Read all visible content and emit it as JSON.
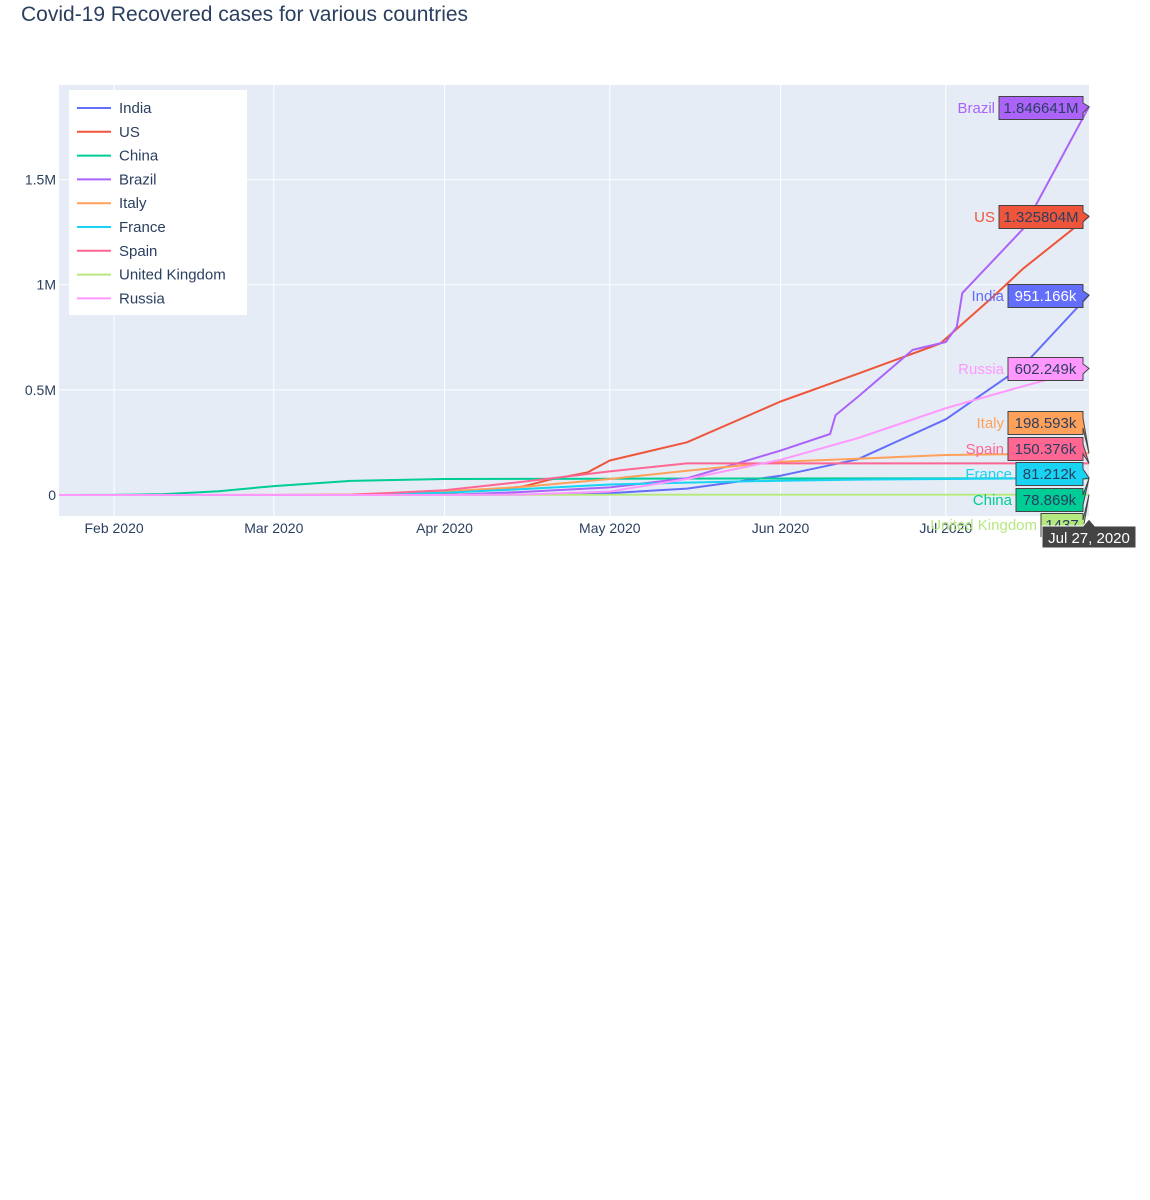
{
  "chart_data": {
    "type": "line",
    "title": "Covid-19 Recovered cases for various countries",
    "xlabel": "",
    "ylabel": "",
    "x_tick_labels": [
      "Feb 2020",
      "Mar 2020",
      "Apr 2020",
      "May 2020",
      "Jun 2020",
      "Jul 2020"
    ],
    "y_tick_labels": [
      "0",
      "0.5M",
      "1M",
      "1.5M"
    ],
    "x_range": [
      "2020-01-22",
      "2020-07-27"
    ],
    "ylim": [
      -100000,
      1950000
    ],
    "grid": true,
    "legend_position": "top-left",
    "hover": {
      "date_label": "Jul 27, 2020",
      "labels": {
        "Brazil": "1.846641M",
        "US": "1.325804M",
        "India": "951.166k",
        "Russia": "602.249k",
        "Italy": "198.593k",
        "Spain": "150.376k",
        "France": "81.212k",
        "China": "78.869k",
        "United Kingdom": "1437"
      }
    },
    "series": [
      {
        "name": "India",
        "color": "#636efa",
        "points": [
          [
            "2020-01-22",
            0
          ],
          [
            "2020-03-15",
            13
          ],
          [
            "2020-04-01",
            169
          ],
          [
            "2020-04-15",
            1749
          ],
          [
            "2020-05-01",
            9064
          ],
          [
            "2020-05-15",
            30153
          ],
          [
            "2020-06-01",
            91819
          ],
          [
            "2020-06-15",
            169798
          ],
          [
            "2020-07-01",
            359860
          ],
          [
            "2020-07-15",
            612815
          ],
          [
            "2020-07-27",
            951166
          ]
        ]
      },
      {
        "name": "US",
        "color": "#ef553b",
        "points": [
          [
            "2020-01-22",
            0
          ],
          [
            "2020-03-15",
            106
          ],
          [
            "2020-04-01",
            8474
          ],
          [
            "2020-04-15",
            38820
          ],
          [
            "2020-04-20",
            72329
          ],
          [
            "2020-04-27",
            108000
          ],
          [
            "2020-05-01",
            164015
          ],
          [
            "2020-05-15",
            250747
          ],
          [
            "2020-06-01",
            444758
          ],
          [
            "2020-06-15",
            576334
          ],
          [
            "2020-06-30",
            720631
          ],
          [
            "2020-07-10",
            953000
          ],
          [
            "2020-07-15",
            1075882
          ],
          [
            "2020-07-27",
            1325804
          ]
        ]
      },
      {
        "name": "China",
        "color": "#00cc96",
        "points": [
          [
            "2020-01-22",
            28
          ],
          [
            "2020-02-01",
            300
          ],
          [
            "2020-02-10",
            4000
          ],
          [
            "2020-02-20",
            18000
          ],
          [
            "2020-03-01",
            42000
          ],
          [
            "2020-03-15",
            67000
          ],
          [
            "2020-04-01",
            76000
          ],
          [
            "2020-05-01",
            77600
          ],
          [
            "2020-06-01",
            78300
          ],
          [
            "2020-07-01",
            78800
          ],
          [
            "2020-07-27",
            78869
          ]
        ]
      },
      {
        "name": "Brazil",
        "color": "#ab63fa",
        "points": [
          [
            "2020-01-22",
            0
          ],
          [
            "2020-04-01",
            120
          ],
          [
            "2020-04-15",
            14026
          ],
          [
            "2020-05-01",
            35935
          ],
          [
            "2020-05-15",
            79479
          ],
          [
            "2020-06-01",
            211080
          ],
          [
            "2020-06-10",
            290000
          ],
          [
            "2020-06-11",
            380000
          ],
          [
            "2020-06-15",
            466000
          ],
          [
            "2020-06-25",
            690000
          ],
          [
            "2020-07-01",
            727715
          ],
          [
            "2020-07-03",
            800000
          ],
          [
            "2020-07-04",
            960000
          ],
          [
            "2020-07-15",
            1264843
          ],
          [
            "2020-07-27",
            1846641
          ]
        ]
      },
      {
        "name": "Italy",
        "color": "#ffa15a",
        "points": [
          [
            "2020-01-22",
            0
          ],
          [
            "2020-03-01",
            83
          ],
          [
            "2020-03-15",
            2335
          ],
          [
            "2020-04-01",
            16847
          ],
          [
            "2020-04-15",
            38092
          ],
          [
            "2020-05-01",
            75945
          ],
          [
            "2020-05-15",
            115288
          ],
          [
            "2020-06-01",
            158355
          ],
          [
            "2020-06-15",
            172753
          ],
          [
            "2020-07-01",
            190248
          ],
          [
            "2020-07-27",
            198593
          ]
        ]
      },
      {
        "name": "France",
        "color": "#19d3f3",
        "points": [
          [
            "2020-01-22",
            0
          ],
          [
            "2020-03-15",
            12
          ],
          [
            "2020-04-01",
            10934
          ],
          [
            "2020-04-15",
            28000
          ],
          [
            "2020-05-01",
            50000
          ],
          [
            "2020-05-15",
            59000
          ],
          [
            "2020-06-01",
            68000
          ],
          [
            "2020-06-15",
            73000
          ],
          [
            "2020-07-01",
            76000
          ],
          [
            "2020-07-27",
            81212
          ]
        ]
      },
      {
        "name": "Spain",
        "color": "#ff6692",
        "points": [
          [
            "2020-01-22",
            0
          ],
          [
            "2020-03-15",
            1028
          ],
          [
            "2020-04-01",
            22647
          ],
          [
            "2020-04-15",
            62391
          ],
          [
            "2020-05-01",
            112050
          ],
          [
            "2020-05-15",
            150000
          ],
          [
            "2020-06-01",
            150376
          ],
          [
            "2020-07-27",
            150376
          ]
        ]
      },
      {
        "name": "United Kingdom",
        "color": "#b6e880",
        "points": [
          [
            "2020-01-22",
            0
          ],
          [
            "2020-03-15",
            19
          ],
          [
            "2020-04-01",
            359
          ],
          [
            "2020-05-01",
            859
          ],
          [
            "2020-06-01",
            1200
          ],
          [
            "2020-07-01",
            1400
          ],
          [
            "2020-07-27",
            1437
          ]
        ]
      },
      {
        "name": "Russia",
        "color": "#ff97ff",
        "points": [
          [
            "2020-01-22",
            0
          ],
          [
            "2020-04-01",
            121
          ],
          [
            "2020-04-15",
            1986
          ],
          [
            "2020-05-01",
            16639
          ],
          [
            "2020-05-15",
            76130
          ],
          [
            "2020-06-01",
            167469
          ],
          [
            "2020-06-15",
            270000
          ],
          [
            "2020-07-01",
            412650
          ],
          [
            "2020-07-15",
            517000
          ],
          [
            "2020-07-27",
            602249
          ]
        ]
      }
    ]
  }
}
